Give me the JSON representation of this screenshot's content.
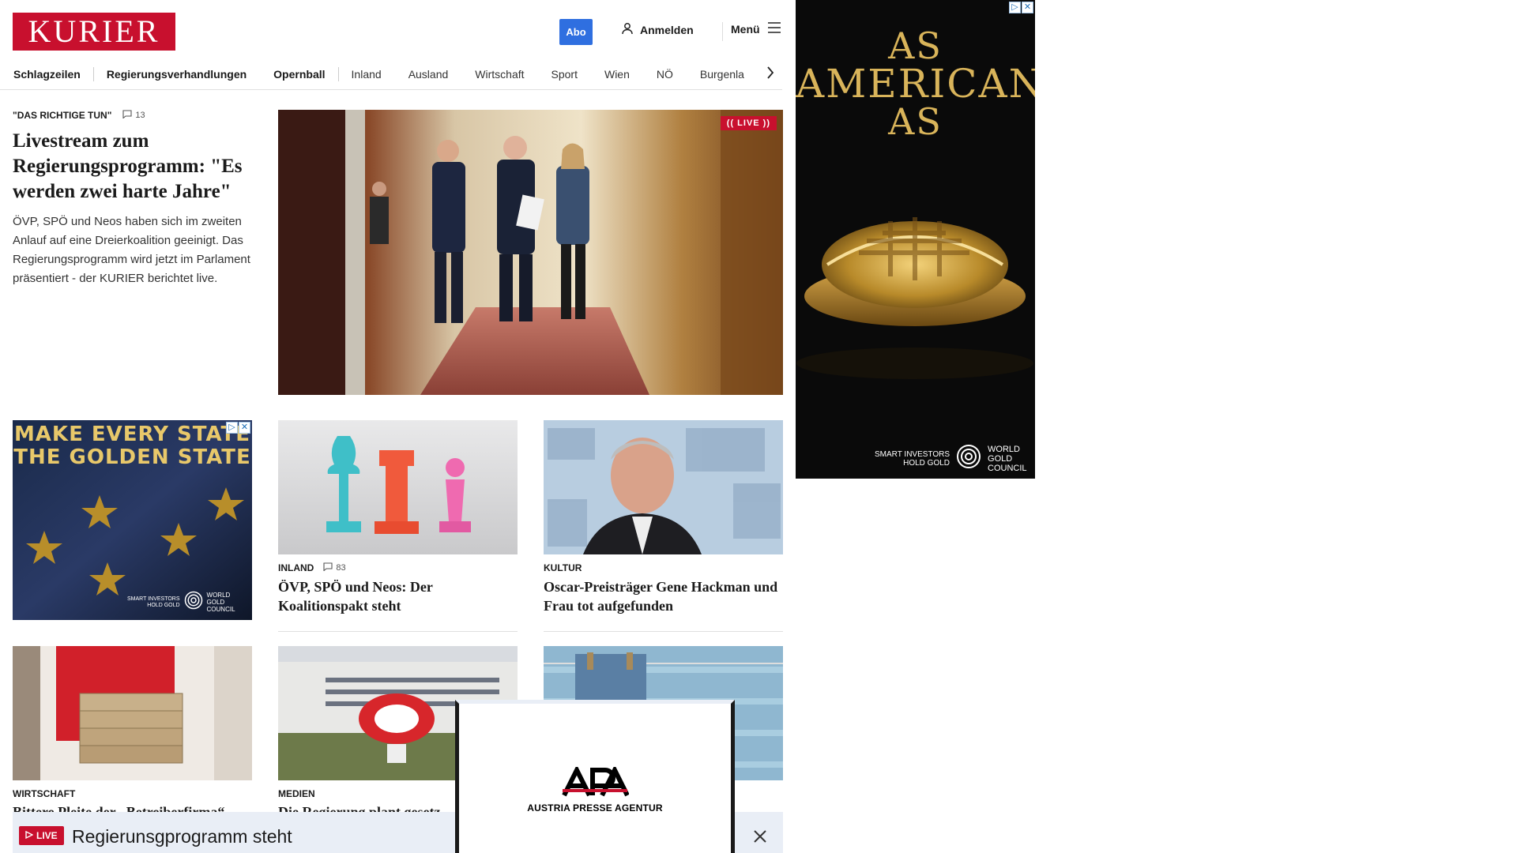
{
  "header": {
    "logo_text": "KURIER",
    "abo_label": "Abo",
    "login_label": "Anmelden",
    "menu_label": "Menü"
  },
  "nav": {
    "items": [
      "Schlagzeilen",
      "Regierungsverhandlungen",
      "Opernball",
      "Inland",
      "Ausland",
      "Wirtschaft",
      "Sport",
      "Wien",
      "NÖ",
      "Burgenla"
    ]
  },
  "lead": {
    "kicker": "\"DAS RICHTIGE TUN\"",
    "comment_count": "13",
    "title": "Livestream zum Regierungsprogramm: \"Es werden zwei harte Jahre\"",
    "teaser": "ÖVP, SPÖ und Neos haben sich im zweiten Anlauf auf eine Dreierkoalition geeinigt. Das Regierungsprogramm wird jetzt im Parlament präsentiert - der KURIER berichtet live.",
    "live_badge": "(( LIVE ))"
  },
  "ads": {
    "small_headline_1": "MAKE EVERY STATE",
    "small_headline_2": "THE GOLDEN STATE",
    "right_headline_1": "AS",
    "right_headline_2": "AMERICAN",
    "right_headline_3": "AS",
    "tagline_1": "SMART INVESTORS",
    "tagline_2": "HOLD GOLD",
    "brand_1": "WORLD",
    "brand_2": "GOLD",
    "brand_3": "COUNCIL"
  },
  "cards": [
    {
      "kicker": "INLAND",
      "comment_count": "83",
      "title": "ÖVP, SPÖ und Neos: Der Koalitionspakt steht"
    },
    {
      "kicker": "KULTUR",
      "title": "Oscar-Preisträger Gene Hackman und Frau tot aufgefunden"
    },
    {
      "kicker": "WIRTSCHAFT",
      "title": "Bittere Pleite der „Betreiberfirma“"
    },
    {
      "kicker": "MEDIEN",
      "title": "Die Regierung plant gesetz"
    }
  ],
  "live_bar": {
    "pill": "LIVE",
    "text": "Regierunsgprogramm steht"
  },
  "apa": {
    "logo": "APA",
    "subtitle": "AUSTRIA PRESSE AGENTUR"
  }
}
